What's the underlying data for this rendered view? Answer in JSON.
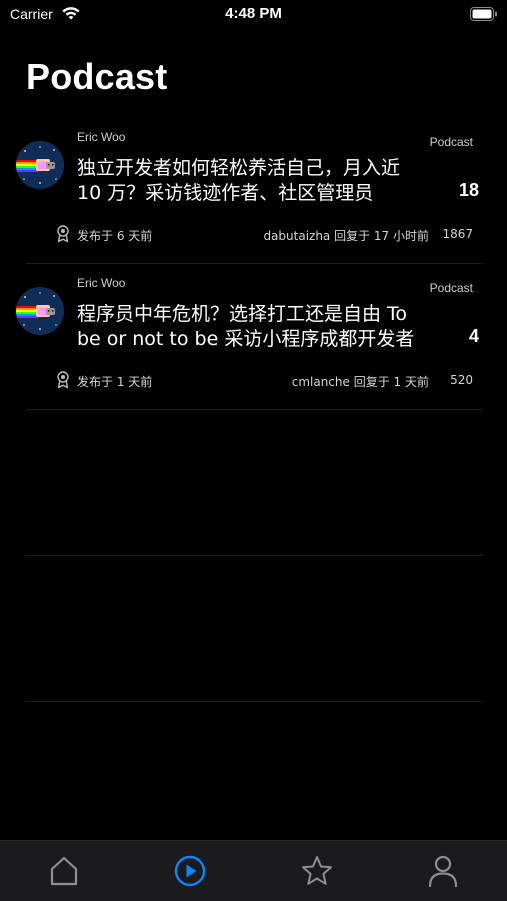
{
  "status_bar": {
    "carrier": "Carrier",
    "time": "4:48 PM"
  },
  "header": {
    "title": "Podcast"
  },
  "topics": [
    {
      "author": "Eric Woo",
      "node": "Podcast",
      "title": "独立开发者如何轻松养活自己，月入近 10 万？采访钱迹作者、社区管理员",
      "replies": "18",
      "posted": "发布于 6 天前",
      "last_reply": "dabutaizha 回复于 17 小时前",
      "views": "1867"
    },
    {
      "author": "Eric Woo",
      "node": "Podcast",
      "title": "程序员中年危机？选择打工还是自由 To be or not to be 采访小程序成都开发者",
      "replies": "4",
      "posted": "发布于 1 天前",
      "last_reply": "cmlanche 回复于 1 天前",
      "views": "520"
    }
  ],
  "tab_bar": {
    "tabs": [
      {
        "icon": "home-icon",
        "active": false
      },
      {
        "icon": "play-circle-icon",
        "active": true
      },
      {
        "icon": "star-icon",
        "active": false
      },
      {
        "icon": "person-icon",
        "active": false
      }
    ],
    "active_color": "#0a84ff",
    "inactive_color": "#8e8e93"
  },
  "colors": {
    "background": "#000000",
    "text": "#ffffff",
    "secondary_text": "#cfcfcf",
    "avatar_bg": "#0f2d57"
  }
}
